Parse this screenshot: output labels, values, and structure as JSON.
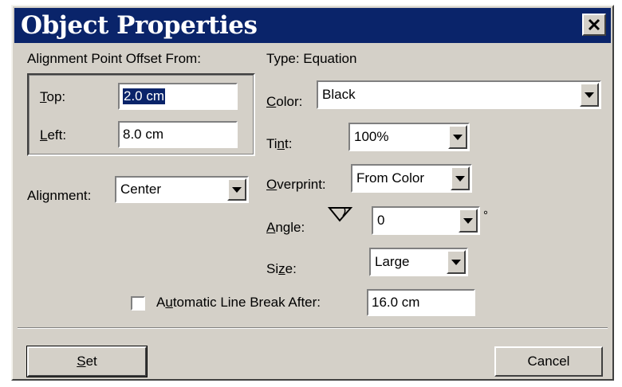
{
  "window": {
    "title": "Object Properties",
    "close_glyph": "X"
  },
  "offset": {
    "heading": "Alignment Point Offset From:",
    "top_label_u": "T",
    "top_label_rest": "op:",
    "top_value": "2.0 cm",
    "left_label_u": "L",
    "left_label_rest": "eft:",
    "left_value": "8.0 cm"
  },
  "alignment": {
    "label_pre": "Ali",
    "label_u": "g",
    "label_post": "nment:",
    "value": "Center"
  },
  "type": {
    "label": "Type: Equation"
  },
  "color": {
    "label_u": "C",
    "label_rest": "olor:",
    "value": "Black"
  },
  "tint": {
    "label_pre": "Ti",
    "label_u": "n",
    "label_post": "t:",
    "value": "100%"
  },
  "overprint": {
    "label_u": "O",
    "label_rest": "verprint:",
    "value": "From Color"
  },
  "angle": {
    "label_u": "A",
    "label_rest": "ngle:",
    "icon": "angle-icon",
    "value": "0",
    "unit": "°"
  },
  "size": {
    "label_pre": "Si",
    "label_u": "z",
    "label_post": "e:",
    "value": "Large"
  },
  "line_break": {
    "checked": false,
    "label_pre": "A",
    "label_u": "u",
    "label_post": "tomatic Line Break After:",
    "value": "16.0 cm"
  },
  "buttons": {
    "set_u": "S",
    "set_rest": "et",
    "cancel": "Cancel"
  },
  "colors": {
    "titlebar": "#0a246a",
    "face": "#d4d0c8",
    "selection": "#0a246a"
  }
}
